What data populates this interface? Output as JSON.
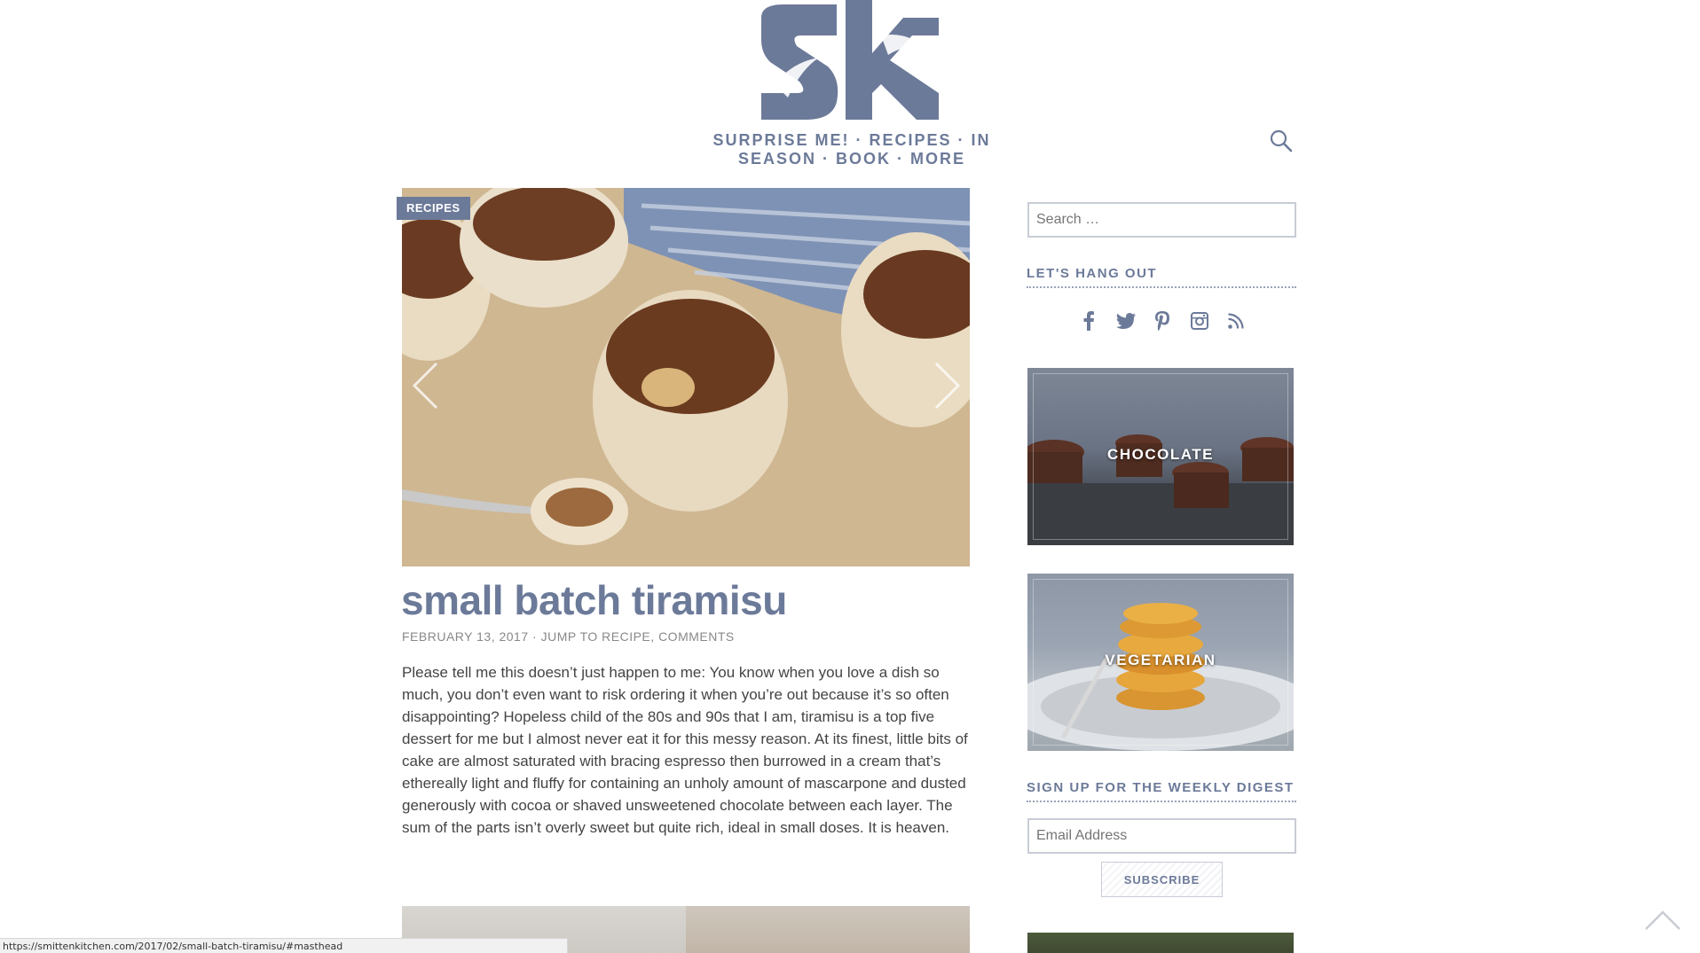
{
  "nav": {
    "items": [
      "SURPRISE ME!",
      "RECIPES",
      "IN SEASON",
      "BOOK",
      "MORE"
    ],
    "separator": "·"
  },
  "post": {
    "category_badge": "RECIPES",
    "title": "small batch tiramisu",
    "date": "FEBRUARY 13, 2017",
    "meta_sep": " · ",
    "jump_link": "JUMP TO RECIPE",
    "comments_link": "COMMENTS",
    "excerpt": "Please tell me this doesn’t just happen to me: You know when you love a dish so much, you don’t even want to risk ordering it when you’re out because it’s so often disappointing? Hopeless child of the 80s and 90s that I am, tiramisu is a top five dessert for me but I almost never eat it for this messy reason. At its finest, little bits of cake are almost saturated with bracing espresso then burrowed in a cream that’s ethereally light and fluffy for containing an unholy amount of mascarpone and dusted generously with cocoa or shaved unsweetened chocolate between each layer. The sum of the parts isn’t overly sweet but quite rich, ideal in small doses. It is heaven."
  },
  "sidebar": {
    "search_placeholder": "Search …",
    "hang_out_heading": "LET'S HANG OUT",
    "social_icons": [
      "facebook-icon",
      "twitter-icon",
      "pinterest-icon",
      "instagram-icon",
      "rss-icon"
    ],
    "categories": [
      "CHOCOLATE",
      "VEGETARIAN"
    ],
    "digest_heading": "SIGN UP FOR THE WEEKLY DIGEST",
    "email_placeholder": "Email Address",
    "subscribe_label": "SUBSCRIBE"
  },
  "status_url": "https://smittenkitchen.com/2017/02/small-batch-tiramisu/#masthead",
  "colors": {
    "accent": "#6c7a99",
    "text": "#444444"
  }
}
